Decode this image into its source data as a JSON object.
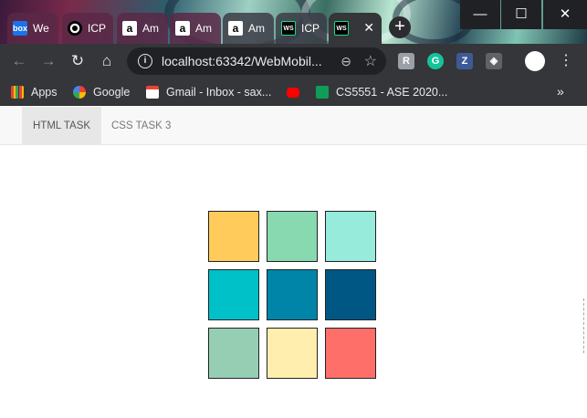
{
  "browser": {
    "tabs": [
      {
        "label": "We",
        "icon": "box",
        "icon_text": "box"
      },
      {
        "label": "ICP",
        "icon": "github",
        "icon_text": ""
      },
      {
        "label": "Am",
        "icon": "amazon",
        "icon_text": "a"
      },
      {
        "label": "Am",
        "icon": "amazon",
        "icon_text": "a"
      },
      {
        "label": "Am",
        "icon": "amazon",
        "icon_text": "a"
      },
      {
        "label": "ICP",
        "icon": "webstorm",
        "icon_text": "WS"
      },
      {
        "label": "",
        "icon": "webstorm",
        "icon_text": "WS",
        "active": true
      }
    ],
    "active_tab_close": "✕",
    "new_tab": "+",
    "window_controls": {
      "minimize": "—",
      "maximize": "☐",
      "close": "✕"
    },
    "nav": {
      "back": "←",
      "forward": "→",
      "reload": "↻",
      "home": "⌂"
    },
    "omnibox": {
      "info_icon": "i",
      "url": "localhost:63342/WebMobil...",
      "zoom_icon": "⊖",
      "star_icon": "☆"
    },
    "extensions": [
      {
        "name": "reader-extension-icon",
        "glyph": "R",
        "color": "#9aa0a6"
      },
      {
        "name": "grammarly-icon",
        "glyph": "G",
        "color": "#15c39a"
      },
      {
        "name": "zotero-icon",
        "glyph": "Z",
        "color": "#3d5a98"
      },
      {
        "name": "shield-extension-icon",
        "glyph": "◈",
        "color": "#5f6368"
      }
    ],
    "menu_icon": "⋮"
  },
  "bookmarks": [
    {
      "label": "Apps",
      "icon": "apps-grid",
      "color": "#ea4335"
    },
    {
      "label": "Google",
      "icon": "google",
      "color": "#4285f4"
    },
    {
      "label": "Gmail - Inbox - sax...",
      "icon": "gmail",
      "color": "#ea4335"
    },
    {
      "label": "",
      "icon": "youtube",
      "color": "#ff0000"
    },
    {
      "label": "CS5551 - ASE 2020...",
      "icon": "classroom",
      "color": "#0f9d58"
    }
  ],
  "bookmarks_more": "»",
  "page": {
    "nav": [
      {
        "label": "HTML TASK",
        "active": true
      },
      {
        "label": "CSS TASK 3",
        "active": false
      }
    ],
    "grid": {
      "colors": [
        "#ffcc5c",
        "#88d8b0",
        "#96ebdb",
        "#00c0c8",
        "#0084a8",
        "#005784",
        "#96ceb4",
        "#ffeead",
        "#ff6f69"
      ]
    }
  }
}
